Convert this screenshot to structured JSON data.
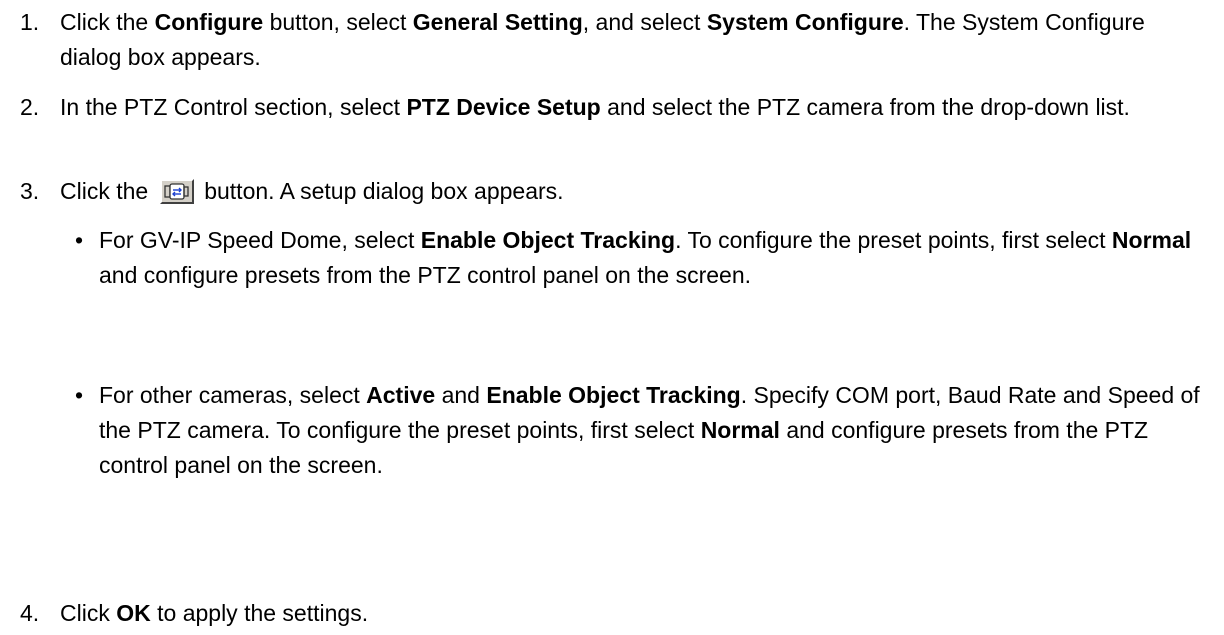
{
  "steps": [
    {
      "num": "1.",
      "t1": "Click the ",
      "b1": "Configure",
      "t2": " button, select ",
      "b2": "General Setting",
      "t3": ", and select ",
      "b3": "System Configure",
      "t4": ". The System Configure dialog box appears."
    },
    {
      "num": "2.",
      "t1": "In the PTZ Control section, select ",
      "b1": "PTZ Device Setup",
      "t2": " and select the PTZ camera from the drop-down list."
    },
    {
      "num": "3.",
      "t1": "Click the",
      "button_icon": "setup-button-icon",
      "t2": "button. A setup dialog box appears."
    },
    {
      "num": "4.",
      "t1": "Click ",
      "b1": "OK",
      "t2": " to apply the settings."
    }
  ],
  "bullets": [
    {
      "dot": "•",
      "t1": "For GV-IP Speed Dome, select ",
      "b1": "Enable Object Tracking",
      "t2": ". To configure the preset points, first select ",
      "b2": "Normal",
      "t3": " and configure presets from the PTZ control panel on the screen."
    },
    {
      "dot": "•",
      "t1": "For other cameras, select ",
      "b1": "Active",
      "t2": " and ",
      "b2": "Enable Object Tracking",
      "t3": ". Specify COM port, Baud Rate and Speed of the PTZ camera. To configure the preset points, first select ",
      "b3": "Normal",
      "t4": " and configure presets from the PTZ control panel on the screen."
    }
  ]
}
